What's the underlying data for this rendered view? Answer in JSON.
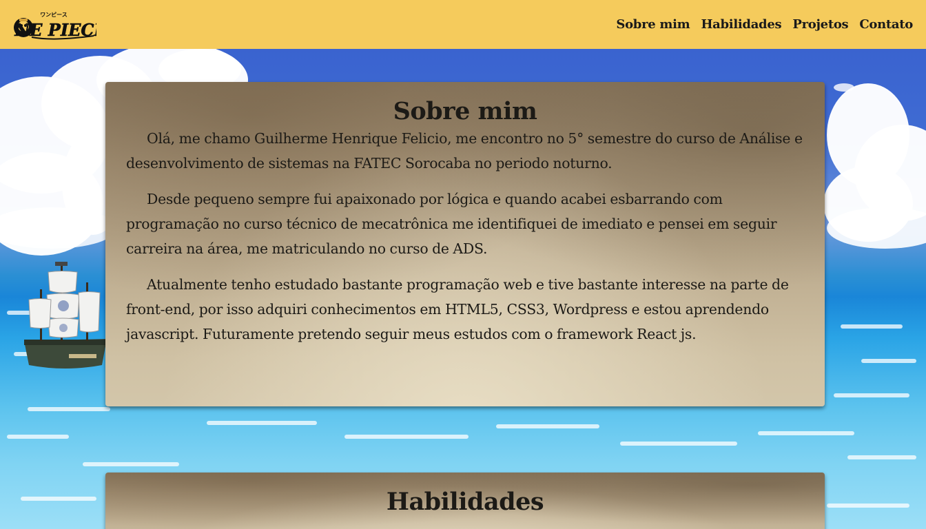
{
  "header": {
    "logo_icon": "one-piece-logo",
    "background_color": "#f5cb5c",
    "nav": [
      {
        "label": "Sobre mim"
      },
      {
        "label": "Habilidades"
      },
      {
        "label": "Projetos"
      },
      {
        "label": "Contato"
      }
    ]
  },
  "about": {
    "title": "Sobre mim",
    "paragraphs": [
      "Olá, me chamo Guilherme Henrique Felicio, me encontro no 5° semestre do curso de Análise e desenvolvimento de sistemas na FATEC Sorocaba no periodo noturno.",
      "Desde pequeno sempre fui apaixonado por lógica e quando acabei esbarrando com programação no curso técnico de mecatrônica me identifiquei de imediato e pensei em seguir carreira na área, me matriculando no curso de ADS.",
      "Atualmente tenho estudado bastante programação web e tive bastante interesse na parte de front-end, por isso adquiri conhecimentos em HTML5, CSS3, Wordpress e estou aprendendo javascript. Futuramente pretendo seguir meus estudos com o framework React js."
    ]
  },
  "skills": {
    "title": "Habilidades"
  },
  "background": {
    "scene": "ocean-sky-background",
    "ship_icon": "pirate-ship-icon"
  }
}
